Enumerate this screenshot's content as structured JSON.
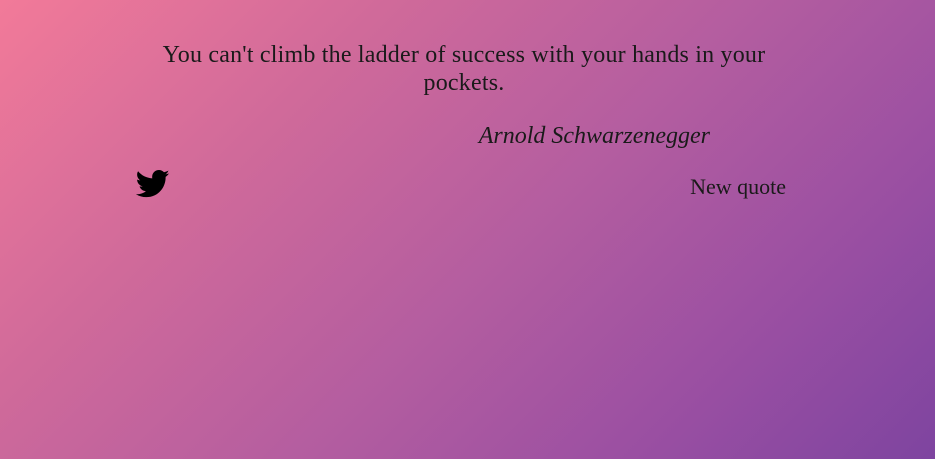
{
  "quote": {
    "text": "You can't climb the ladder of success with your hands in your pockets.",
    "author": "Arnold Schwarzenegger"
  },
  "actions": {
    "tweet_icon": "twitter-bird-icon",
    "new_quote_label": "New quote"
  },
  "colors": {
    "gradient_start": "#f27a99",
    "gradient_end": "#7e44a0",
    "text": "#1a1a1a"
  }
}
